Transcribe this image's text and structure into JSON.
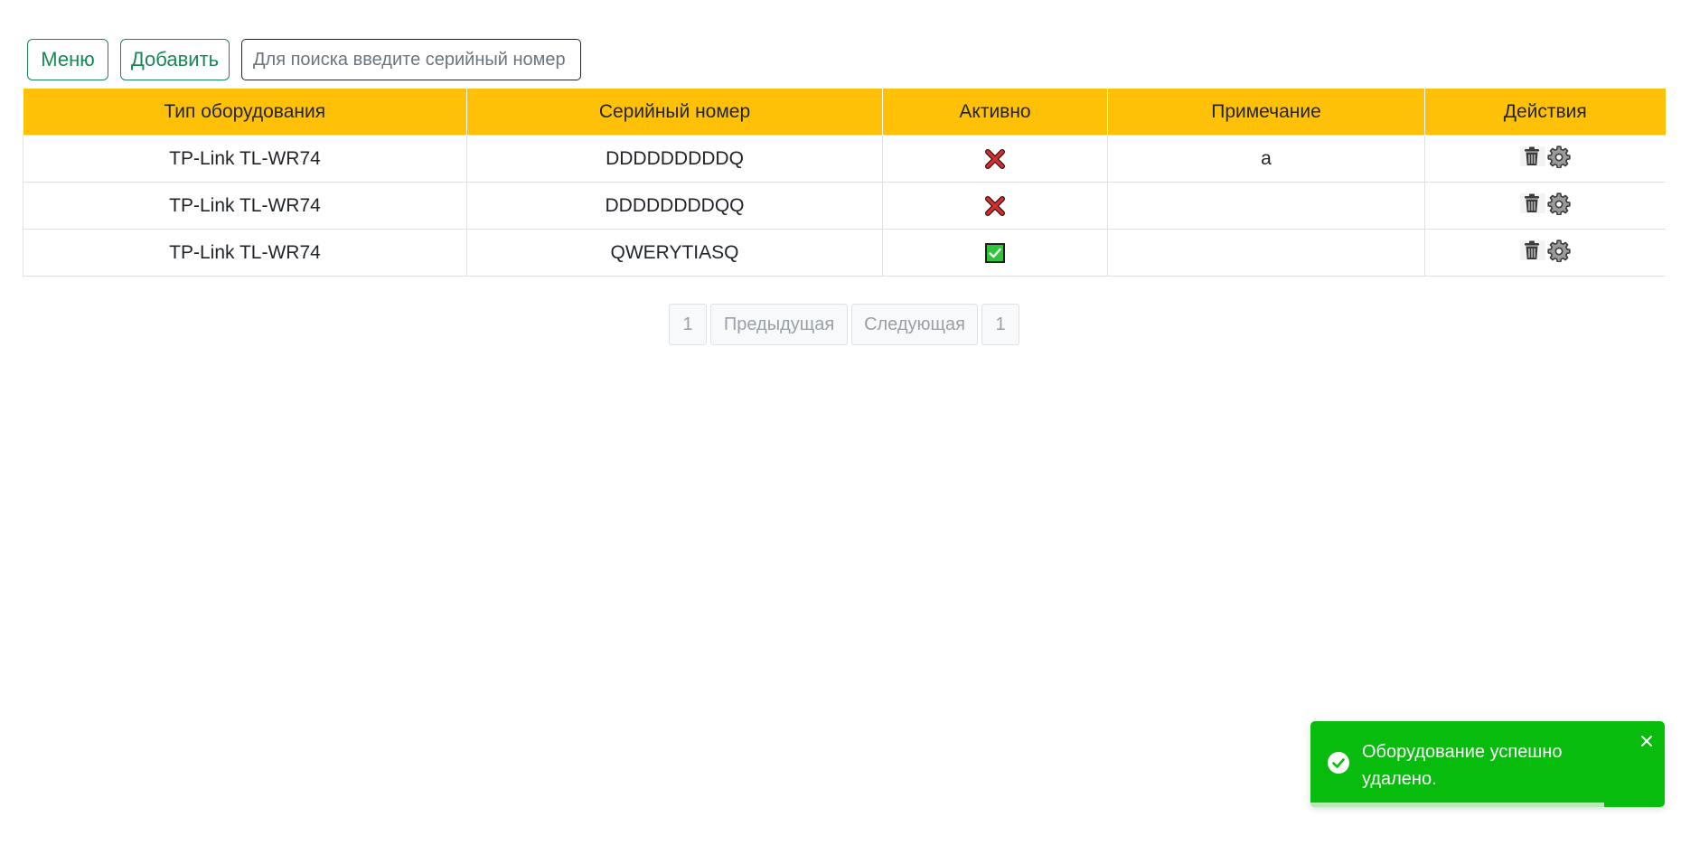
{
  "toolbar": {
    "menu_label": "Меню",
    "add_label": "Добавить",
    "search_placeholder": "Для поиска введите серийный номер",
    "search_value": ""
  },
  "table": {
    "columns": [
      "Тип оборудования",
      "Серийный номер",
      "Активно",
      "Примечание",
      "Действия"
    ],
    "rows": [
      {
        "type": "TP-Link TL-WR74",
        "serial": "DDDDDDDDDQ",
        "active": false,
        "note": "a"
      },
      {
        "type": "TP-Link TL-WR74",
        "serial": "DDDDDDDDQQ",
        "active": false,
        "note": ""
      },
      {
        "type": "TP-Link TL-WR74",
        "serial": "QWERYTIASQ",
        "active": true,
        "note": ""
      }
    ],
    "action_icons": [
      "trash-icon",
      "gear-icon"
    ],
    "active_icons": {
      "true": "green-check-icon",
      "false": "red-x-icon"
    }
  },
  "pagination": {
    "first": "1",
    "prev": "Предыдущая",
    "next": "Следующая",
    "last": "1"
  },
  "toast": {
    "message": "Оборудование успешно удалено.",
    "progress_remaining": 0.83,
    "icon": "check-circle-icon",
    "close_icon": "close-icon"
  },
  "colors": {
    "header_bg": "#ffc107",
    "button_accent": "#198754",
    "toast_bg": "#07bc0c",
    "active_true": "#2fc53a",
    "active_false": "#d32f2f"
  }
}
